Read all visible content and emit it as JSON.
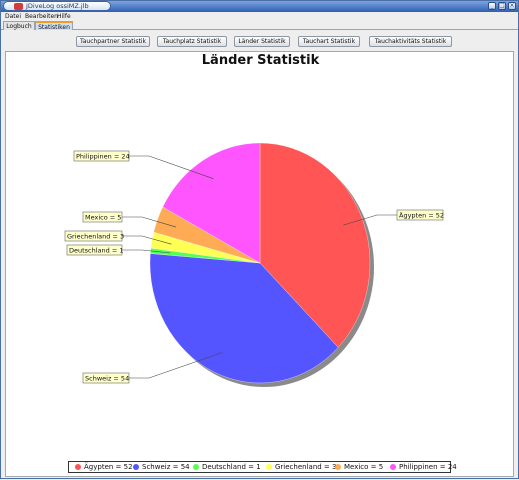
{
  "window": {
    "title": "JDiveLog ossiMZ.jlb",
    "controls": [
      "_",
      "□",
      "×"
    ]
  },
  "menu": {
    "items": [
      "Datei",
      "Bearbeiten",
      "Hilfe"
    ]
  },
  "tabs": [
    {
      "label": "Logbuch",
      "active": false
    },
    {
      "label": "Statistiken",
      "active": true
    }
  ],
  "toolbar": {
    "buttons": [
      "Tauchpartner Statistik",
      "Tauchplatz Statistik",
      "Länder Statistik",
      "Tauchart Statistik",
      "Tauchaktivitäts Statistik"
    ]
  },
  "chart_data": {
    "type": "pie",
    "title": "Länder Statistik",
    "categories": [
      "Ägypten",
      "Schweiz",
      "Deutschland",
      "Griechenland",
      "Mexico",
      "Philippinen"
    ],
    "values": [
      52,
      54,
      1,
      3,
      5,
      24
    ],
    "colors": [
      "#ff5555",
      "#5555ff",
      "#55ff55",
      "#ffff55",
      "#ffaa55",
      "#ff55ff"
    ],
    "labels": [
      "Ägypten = 52",
      "Schweiz = 54",
      "Deutschland = 1",
      "Griechenland = 3",
      "Mexico = 5",
      "Philippinen = 24"
    ],
    "legend_position": "bottom"
  }
}
